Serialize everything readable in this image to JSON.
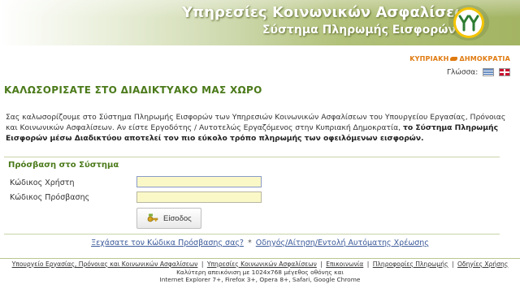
{
  "header": {
    "title": "Υπηρεσίες Κοινωνικών Ασφαλίσεων",
    "subtitle": "Σύστημα Πληρωμής Εισφορών"
  },
  "republic": {
    "left": "ΚΥΠΡΙΑΚΗ",
    "right": "ΔΗΜΟΚΡΑΤΙΑ"
  },
  "language": {
    "label": "Γλώσσα:"
  },
  "welcome": "ΚΑΛΩΣΟΡΙΣΑΤΕ ΣΤΟ ΔΙΑΔΙΚΤΥΑΚΟ ΜΑΣ ΧΩΡΟ",
  "intro": {
    "plain": "Σας καλωσορίζουμε στο Σύστημα Πληρωμής Εισφορών των Υπηρεσιών Κοινωνικών Ασφαλίσεων του Υπουργείου Εργασίας, Πρόνοιας και Κοινωνικών Ασφαλίσεων. Αν είστε Εργοδότης / Αυτοτελώς Εργαζόμενος στην Κυπριακή Δημοκρατία, ",
    "bold": "το Σύστημα Πληρωμής Εισφορών μέσω Διαδικτύου αποτελεί τον πιο εύκολο τρόπο πληρωμής των οφειλόμενων εισφορών."
  },
  "login": {
    "section_title": "Πρόσβαση στο Σύστημα",
    "username_label": "Κώδικος Χρήστη",
    "password_label": "Κώδικος Πρόσβασης",
    "username_value": "",
    "password_value": "",
    "submit_label": "Είσοδος"
  },
  "links": {
    "forgot": "Ξεχάσατε τον Κώδικα Πρόσβασης σας?",
    "separator": "*",
    "guide": "Οδηγός/Αίτηση/Εντολή Αυτόματης Χρέωσης"
  },
  "footer": {
    "items": [
      "Υπουργείο Εργασίας, Πρόνοιας και Κοινωνικών Ασφαλίσεων",
      "Υπηρεσίες Κοινωνικών Ασφαλίσεων",
      "Επικοινωνία",
      "Πληροφορίες Πληρωμής",
      "Οδηγίες Χρήσης"
    ],
    "separator": "|",
    "note_line1": "Καλύτερη απεικόνιση με 1024x768 μέγεθος οθόνης και",
    "note_line2": "Internet Explorer 7+, Firefox 3+, Opera 8+, Safari, Google Chrome"
  },
  "colors": {
    "accent_green": "#4b7a1a",
    "banner_green": "#a3b463",
    "republic_orange": "#e07a10",
    "input_bg": "#fbf8c8"
  }
}
